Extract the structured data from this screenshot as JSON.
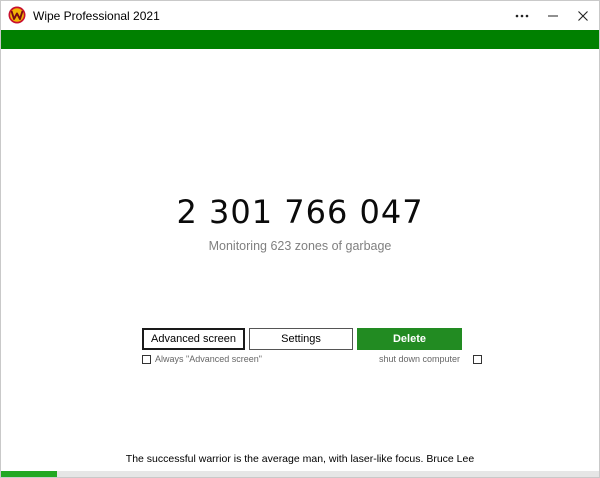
{
  "window": {
    "title": "Wipe Professional 2021",
    "more_icon": "more-horizontal-icon",
    "minimize_icon": "minimize-icon",
    "close_icon": "close-icon",
    "brand_green": "#008000"
  },
  "main": {
    "counter": "2 301 766 047",
    "status": "Monitoring 623 zones of garbage"
  },
  "buttons": {
    "advanced": "Advanced screen",
    "settings": "Settings",
    "delete": "Delete",
    "delete_color": "#228b22"
  },
  "options": {
    "always_advanced": "Always \"Advanced screen\"",
    "shutdown": "shut down computer"
  },
  "footer": {
    "quote": "The successful warrior is the average man, with laser-like focus. Bruce Lee",
    "progress_fraction": 0.093
  }
}
